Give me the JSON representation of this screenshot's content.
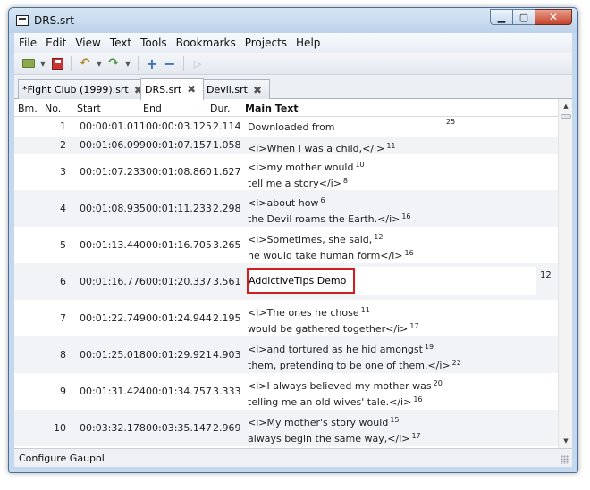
{
  "window": {
    "title": "DRS.srt"
  },
  "menu": [
    "File",
    "Edit",
    "View",
    "Text",
    "Tools",
    "Bookmarks",
    "Projects",
    "Help"
  ],
  "toolbar": {
    "icons": [
      "open-icon",
      "dropdown-arrow",
      "save-icon",
      "undo-icon",
      "dropdown-arrow",
      "redo-icon",
      "dropdown-arrow",
      "insert-icon",
      "remove-icon",
      "play-icon"
    ]
  },
  "tabs": [
    {
      "label": "*Fight Club (1999).srt",
      "active": false
    },
    {
      "label": "DRS.srt",
      "active": true
    },
    {
      "label": "Devil.srt",
      "active": false
    }
  ],
  "columns": {
    "bm": "Bm.",
    "no": "No.",
    "start": "Start",
    "end": "End",
    "dur": "Dur.",
    "text": "Main Text"
  },
  "rows": [
    {
      "no": "1",
      "start": "00:00:01.011",
      "end": "00:00:03.125",
      "dur": "2.114",
      "lines": [
        "Downloaded from"
      ],
      "counts": [
        "25"
      ]
    },
    {
      "no": "2",
      "start": "00:01:06.099",
      "end": "00:01:07.157",
      "dur": "1.058",
      "lines": [
        "<i>When I was a child,</i>"
      ],
      "counts": [
        "11"
      ]
    },
    {
      "no": "3",
      "start": "00:01:07.233",
      "end": "00:01:08.860",
      "dur": "1.627",
      "lines": [
        "<i>my mother would",
        "tell me a story</i>"
      ],
      "counts": [
        "10",
        "8"
      ]
    },
    {
      "no": "4",
      "start": "00:01:08.935",
      "end": "00:01:11.233",
      "dur": "2.298",
      "lines": [
        "<i>about how",
        "the Devil roams the Earth.</i>"
      ],
      "counts": [
        "6",
        "16"
      ]
    },
    {
      "no": "5",
      "start": "00:01:13.440",
      "end": "00:01:16.705",
      "dur": "3.265",
      "lines": [
        "<i>Sometimes, she said,",
        "he would take human form</i>"
      ],
      "counts": [
        "12",
        "16"
      ]
    },
    {
      "no": "6",
      "start": "00:01:16.776",
      "end": "00:01:20.337",
      "dur": "3.561",
      "lines": [
        "AddictiveTips Demo"
      ],
      "counts": [
        "12"
      ],
      "editing": true
    },
    {
      "no": "7",
      "start": "00:01:22.749",
      "end": "00:01:24.944",
      "dur": "2.195",
      "lines": [
        "<i>The ones he chose",
        "would be gathered together</i>"
      ],
      "counts": [
        "11",
        "17"
      ]
    },
    {
      "no": "8",
      "start": "00:01:25.018",
      "end": "00:01:29.921",
      "dur": "4.903",
      "lines": [
        "<i>and tortured as he hid amongst",
        "them, pretending to be one of them.</i>"
      ],
      "counts": [
        "19",
        "22"
      ]
    },
    {
      "no": "9",
      "start": "00:01:31.424",
      "end": "00:01:34.757",
      "dur": "3.333",
      "lines": [
        "<i>I always believed my mother was",
        "telling me an old wives' tale.</i>"
      ],
      "counts": [
        "20",
        "16"
      ]
    },
    {
      "no": "10",
      "start": "00:03:32.178",
      "end": "00:03:35.147",
      "dur": "2.969",
      "lines": [
        "<i>My mother's story would",
        "always begin the same way,</i>"
      ],
      "counts": [
        "15",
        "17"
      ]
    }
  ],
  "status": {
    "text": "Configure Gaupol"
  }
}
